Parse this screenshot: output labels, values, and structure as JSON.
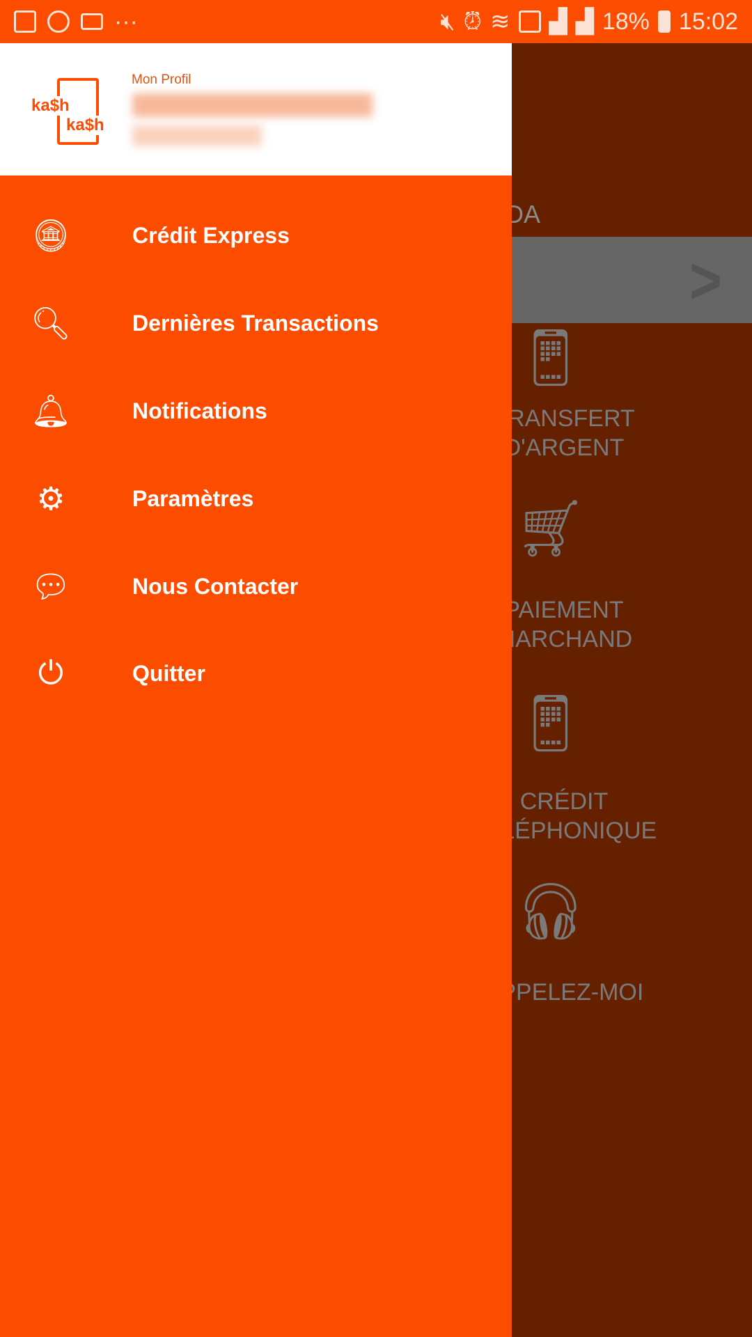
{
  "status_bar": {
    "battery": "18%",
    "time": "15:02",
    "left_icons": [
      "gallery-icon",
      "whatsapp-icon",
      "laptop-icon",
      "more-icon"
    ],
    "right_icons": [
      "mute-icon",
      "alarm-icon",
      "wifi-icon",
      "data-icon",
      "signal-icon",
      "signal-icon",
      "battery-icon"
    ]
  },
  "drawer": {
    "logo_text": "kash kash",
    "profile_label": "Mon Profil",
    "items": [
      {
        "label": "Crédit Express",
        "icon": "hand-coins-icon"
      },
      {
        "label": "Dernières Transactions",
        "icon": "search-document-icon"
      },
      {
        "label": "Notifications",
        "icon": "bell-icon"
      },
      {
        "label": "Paramètres",
        "icon": "gear-icon"
      },
      {
        "label": "Nous Contacter",
        "icon": "chat-icon"
      },
      {
        "label": "Quitter",
        "icon": "power-icon"
      }
    ]
  },
  "background": {
    "partial_title": "UDA",
    "services": [
      {
        "line1": "TRANSFERT",
        "line2": "D'ARGENT",
        "icon": "phone-transfer-icon"
      },
      {
        "line1": "PAIEMENT",
        "line2": "MARCHAND",
        "icon": "cart-icon"
      },
      {
        "line1": "CRÉDIT",
        "line2": "TÉLÉPHONIQUE",
        "icon": "phone-credit-icon"
      },
      {
        "line1": "APPELEZ-MOI",
        "line2": "",
        "icon": "headset-icon"
      }
    ]
  },
  "colors": {
    "brand": "#fb4c00",
    "scrim": "#652000"
  }
}
